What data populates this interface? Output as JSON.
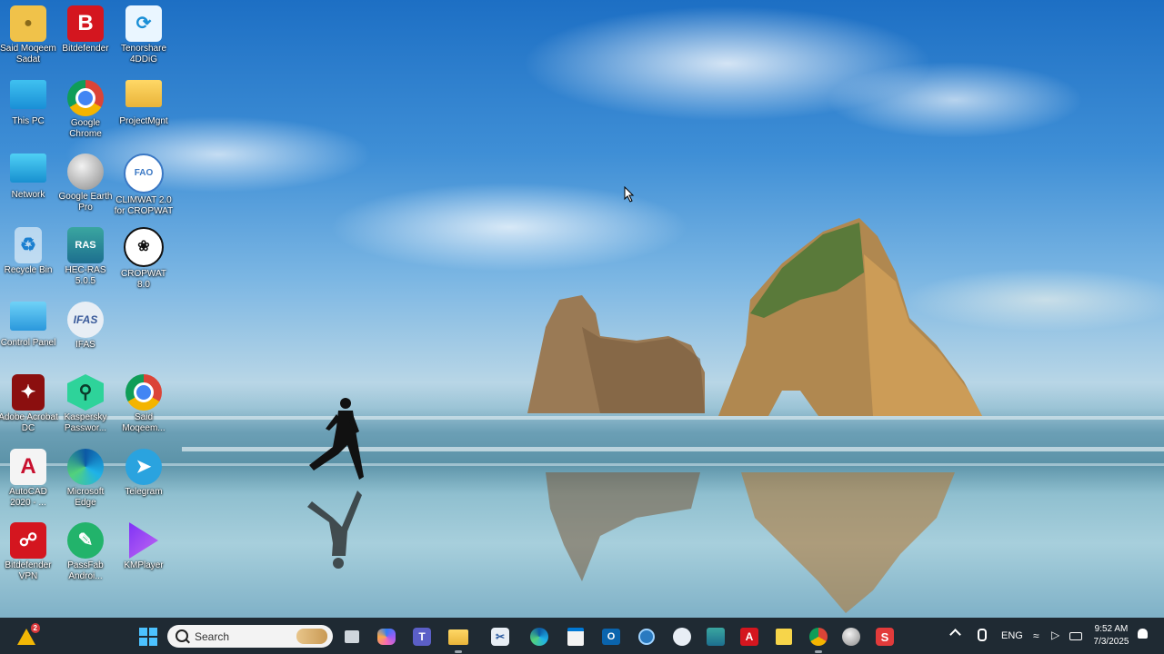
{
  "desktop": {
    "icons": [
      {
        "label": "Said Moqeem Sadat"
      },
      {
        "label": "This PC"
      },
      {
        "label": "Network"
      },
      {
        "label": "Recycle Bin"
      },
      {
        "label": "Control Panel"
      },
      {
        "label": "Adobe Acrobat DC"
      },
      {
        "label": "AutoCAD 2020 - ..."
      },
      {
        "label": "Bitdefender VPN"
      },
      {
        "label": "Bitdefender",
        "glyph": "B"
      },
      {
        "label": "Google Chrome"
      },
      {
        "label": "Google Earth Pro"
      },
      {
        "label": "HEC-RAS 5.0.5",
        "glyph": "RAS"
      },
      {
        "label": "IFAS",
        "glyph": "IFAS"
      },
      {
        "label": "Kaspersky Passwor..."
      },
      {
        "label": "Microsoft Edge"
      },
      {
        "label": "PassFab Androi..."
      },
      {
        "label": "Tenorshare 4DDiG"
      },
      {
        "label": "ProjectMgnt"
      },
      {
        "label": "CLIMWAT 2.0 for CROPWAT"
      },
      {
        "label": "CROPWAT 8.0"
      },
      {
        "label": "Said Moqeem..."
      },
      {
        "label": "Telegram"
      },
      {
        "label": "KMPlayer"
      }
    ]
  },
  "taskbar": {
    "widgets_badge": "2",
    "search_placeholder": "Search",
    "pinned": [
      {
        "name": "task-view"
      },
      {
        "name": "copilot"
      },
      {
        "name": "teams"
      },
      {
        "name": "file-explorer"
      },
      {
        "name": "snipping"
      },
      {
        "name": "edge"
      },
      {
        "name": "store"
      },
      {
        "name": "outlook"
      },
      {
        "name": "search-app"
      },
      {
        "name": "fao-app"
      },
      {
        "name": "hec-ras"
      },
      {
        "name": "acrobat"
      },
      {
        "name": "sticky-notes"
      },
      {
        "name": "chrome"
      },
      {
        "name": "google-earth"
      },
      {
        "name": "wps"
      }
    ],
    "tray": {
      "language": "ENG",
      "time": "9:52 AM",
      "date": "7/3/2025"
    }
  },
  "colors": {
    "taskbar_bg": "#1f2a33",
    "sky_top": "#1d6fc4",
    "accent": "#0078d4"
  }
}
